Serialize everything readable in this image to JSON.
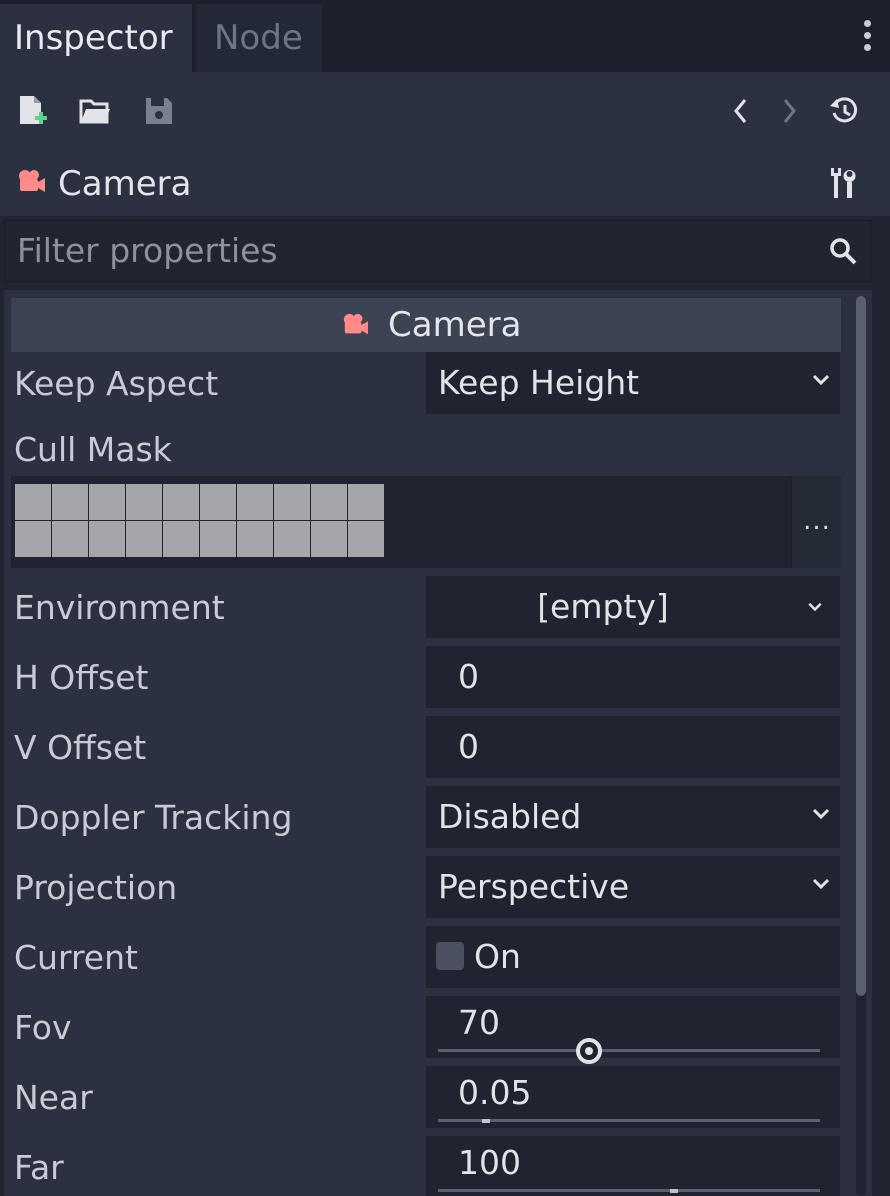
{
  "tabs": [
    {
      "label": "Inspector",
      "active": true
    },
    {
      "label": "Node",
      "active": false
    }
  ],
  "toolbar": {
    "icons": [
      "new-resource-icon",
      "load-resource-icon",
      "save-resource-icon",
      "history-back-icon",
      "history-forward-icon",
      "object-history-icon"
    ]
  },
  "object": {
    "title": "Camera",
    "icon": "camera-icon",
    "icon_color": "#ff8a8a"
  },
  "filter": {
    "placeholder": "Filter properties"
  },
  "section": {
    "title": "Camera"
  },
  "properties": {
    "keep_aspect": {
      "label": "Keep Aspect",
      "value": "Keep Height"
    },
    "cull_mask": {
      "label": "Cull Mask",
      "button": "...",
      "layers": 20
    },
    "environment": {
      "label": "Environment",
      "value": "[empty]"
    },
    "h_offset": {
      "label": "H Offset",
      "value": "0"
    },
    "v_offset": {
      "label": "V Offset",
      "value": "0"
    },
    "doppler_tracking": {
      "label": "Doppler Tracking",
      "value": "Disabled"
    },
    "projection": {
      "label": "Projection",
      "value": "Perspective"
    },
    "current": {
      "label": "Current",
      "value": "On",
      "checked": false
    },
    "fov": {
      "label": "Fov",
      "value": "70"
    },
    "near": {
      "label": "Near",
      "value": "0.05"
    },
    "far": {
      "label": "Far",
      "value": "100"
    }
  },
  "colors": {
    "background": "#202531",
    "panel": "#2b3141",
    "field": "#1f2430",
    "section_header": "#3c4352"
  }
}
